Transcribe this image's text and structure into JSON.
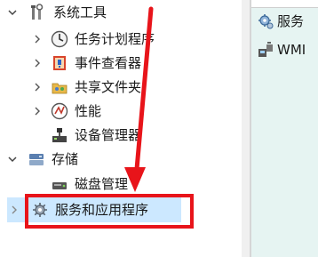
{
  "tree": {
    "system_tools": {
      "label": "系统工具",
      "icon": "tools-icon",
      "expanded": true
    },
    "children": [
      {
        "label": "任务计划程序",
        "icon": "clock-icon"
      },
      {
        "label": "事件查看器",
        "icon": "event-viewer-icon"
      },
      {
        "label": "共享文件夹",
        "icon": "shared-folder-icon"
      },
      {
        "label": "性能",
        "icon": "performance-icon"
      },
      {
        "label": "设备管理器",
        "icon": "device-manager-icon"
      }
    ],
    "storage": {
      "label": "存储",
      "icon": "storage-icon",
      "expanded": true
    },
    "storage_children": [
      {
        "label": "磁盘管理",
        "icon": "disk-management-icon"
      }
    ],
    "services_apps": {
      "label": "服务和应用程序",
      "icon": "services-icon",
      "expanded": false,
      "selected": true
    }
  },
  "right_pane": {
    "items": [
      {
        "label": "服务",
        "icon": "services-gear-icon"
      },
      {
        "label": "WMI",
        "icon": "wmi-icon"
      }
    ]
  },
  "colors": {
    "selection": "#cce8ff",
    "annotation_red": "#e8141a",
    "right_pane_bg": "#e6f4f2"
  }
}
